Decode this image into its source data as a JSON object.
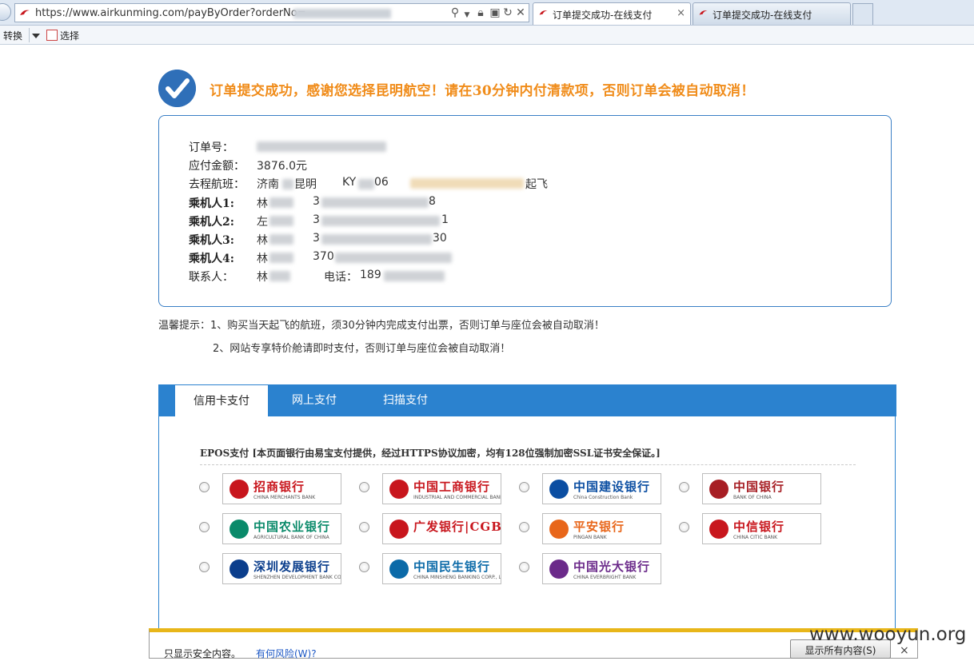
{
  "browser": {
    "url": "https://www.airkunming.com/payByOrder?orderNo=",
    "tabs": [
      {
        "title": "订单提交成功-在线支付",
        "close": "×"
      },
      {
        "title": "订单提交成功-在线支付"
      }
    ],
    "command_bar": {
      "convert_label": "转换",
      "select_label": "选择"
    }
  },
  "page": {
    "success_message": "订单提交成功，感谢您选择昆明航空！请在30分钟内付清款项，否则订单会被自动取消！",
    "order": {
      "order_no_label": "订单号：",
      "amount_label": "应付金额：",
      "amount_value": "3876.0元",
      "flight_label": "去程航班：",
      "flight_route_from": "济南",
      "flight_route_to": "昆明",
      "flight_no_prefix": "KY",
      "flight_no_suffix": "06",
      "departure_suffix": "起飞",
      "passengers": [
        {
          "label": "乘机人1:",
          "name": "林",
          "id_prefix": "3",
          "id_suffix": "8"
        },
        {
          "label": "乘机人2:",
          "name": "左",
          "id_prefix": "3",
          "id_suffix": "1"
        },
        {
          "label": "乘机人3:",
          "name": "林",
          "id_prefix": "3",
          "id_suffix": "30"
        },
        {
          "label": "乘机人4:",
          "name": "林",
          "id_prefix": "370",
          "id_suffix": ""
        }
      ],
      "contact_label": "联系人：",
      "contact_name": "林",
      "phone_label": "电话：",
      "phone_prefix": "189"
    },
    "tips": {
      "line1": "温馨提示：1、购买当天起飞的航班，须30分钟内完成支付出票，否则订单与座位会被自动取消！",
      "line2": "2、网站专享特价舱请即时支付，否则订单与座位会被自动取消！"
    },
    "payment": {
      "tabs": [
        "信用卡支付",
        "网上支付",
        "扫描支付"
      ],
      "active_tab": 0,
      "epos_title": "EPOS支付 [本页面银行由易宝支付提供，经过HTTPS协议加密，均有128位强制加密SSL证书安全保证。]",
      "banks": [
        {
          "name": "招商银行",
          "en": "CHINA MERCHANTS BANK",
          "color": "#c8161d"
        },
        {
          "name": "中国工商银行",
          "en": "INDUSTRIAL AND COMMERCIAL BANK OF CHINA",
          "color": "#c8161d"
        },
        {
          "name": "中国建设银行",
          "en": "China Construction Bank",
          "color": "#0b4ea2"
        },
        {
          "name": "中国银行",
          "en": "BANK OF CHINA",
          "color": "#a71e24"
        },
        {
          "name": "中国农业银行",
          "en": "AGRICULTURAL BANK OF CHINA",
          "color": "#0a8a6a"
        },
        {
          "name": "广发银行|CGB",
          "en": "",
          "color": "#c8161d"
        },
        {
          "name": "平安银行",
          "en": "PINGAN BANK",
          "color": "#e8661a"
        },
        {
          "name": "中信银行",
          "en": "CHINA CITIC BANK",
          "color": "#c8161d"
        },
        {
          "name": "深圳发展银行",
          "en": "SHENZHEN DEVELOPMENT BANK CO., LTD.",
          "color": "#0b3e8c"
        },
        {
          "name": "中国民生银行",
          "en": "CHINA MINSHENG BANKING CORP., LTD.",
          "color": "#0b6aa8"
        },
        {
          "name": "中国光大银行",
          "en": "CHINA EVERBRIGHT BANK",
          "color": "#6b2a8a"
        }
      ]
    }
  },
  "security_bar": {
    "message": "只显示安全内容。",
    "link": "有何风险(W)?",
    "button": "显示所有内容(S)",
    "close": "×"
  },
  "watermark": "www.wooyun.org"
}
